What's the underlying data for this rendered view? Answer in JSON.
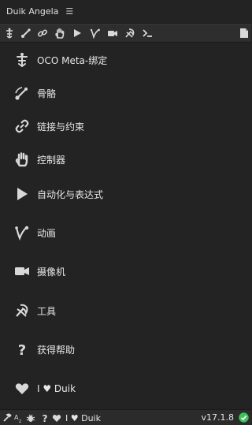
{
  "window": {
    "title": "Duik Angela",
    "menu_icon": "hamburger-icon"
  },
  "toolbar": {
    "buttons": [
      "oco-icon",
      "bone-icon",
      "link-icon",
      "hand-icon",
      "play-icon",
      "animation-icon",
      "camera-icon",
      "tools-icon",
      "terminal-icon"
    ],
    "right_button": "document-icon"
  },
  "menu": {
    "items": [
      {
        "label": "OCO Meta-绑定",
        "icon": "oco-icon"
      },
      {
        "label": "骨骼",
        "icon": "bone-icon"
      },
      {
        "label": "链接与约束",
        "icon": "link-icon"
      },
      {
        "label": "控制器",
        "icon": "hand-icon"
      },
      {
        "label": "自动化与表达式",
        "icon": "play-icon"
      },
      {
        "label": "动画",
        "icon": "animation-icon"
      },
      {
        "label": "摄像机",
        "icon": "camera-icon"
      },
      {
        "label": "工具",
        "icon": "tools-icon"
      },
      {
        "label": "获得帮助",
        "icon": "help-icon"
      },
      {
        "label": "I ♥ Duik",
        "icon": "heart-icon"
      }
    ]
  },
  "status": {
    "love_text": "I ♥ Duik",
    "version": "v17.1.8",
    "ok_color": "#3cc35a"
  }
}
